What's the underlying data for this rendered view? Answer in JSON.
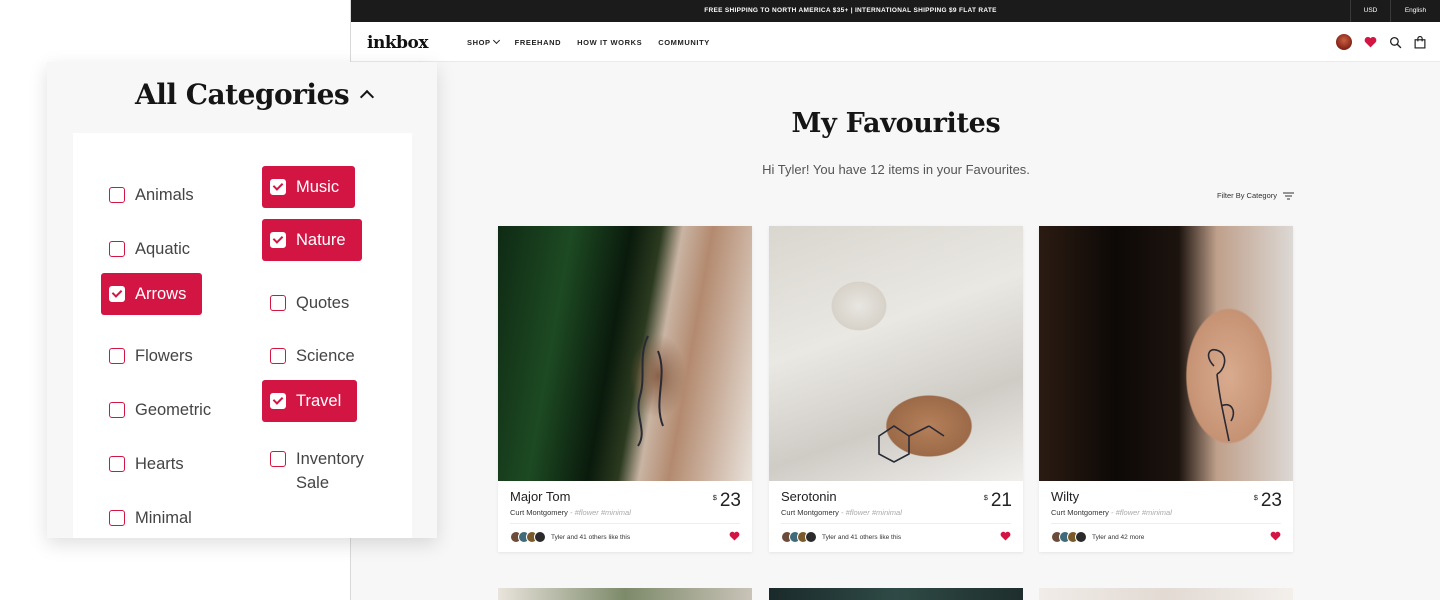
{
  "site": {
    "topbar": {
      "promo": "FREE SHIPPING TO NORTH AMERICA $35+ | INTERNATIONAL SHIPPING $9 FLAT RATE",
      "currency": "USD",
      "language": "English"
    },
    "logo": "inkbox",
    "nav": [
      {
        "label": "SHOP",
        "dropdown": true
      },
      {
        "label": "FREEHAND"
      },
      {
        "label": "HOW IT WORKS"
      },
      {
        "label": "COMMUNITY"
      }
    ],
    "icons": [
      "avatar",
      "heart-icon",
      "search-icon",
      "bag-icon"
    ],
    "accent": "#d31543"
  },
  "favourites": {
    "title": "My Favourites",
    "greeting": "Hi Tyler! You have 12 items in your Favourites.",
    "filter_label": "Filter By Category",
    "items": [
      {
        "name": "Major Tom",
        "artist": "Curt Montgomery",
        "tags": "- #flower #minimal",
        "currency": "$",
        "price": "23",
        "likes": "Tyler and 41 others like this"
      },
      {
        "name": "Serotonin",
        "artist": "Curt Montgomery",
        "tags": "- #flower #minimal",
        "currency": "$",
        "price": "21",
        "likes": "Tyler and 41 others like this"
      },
      {
        "name": "Wilty",
        "artist": "Curt Montgomery",
        "tags": "- #flower #minimal",
        "currency": "$",
        "price": "23",
        "likes": "Tyler and 42 more"
      }
    ]
  },
  "categories": {
    "title": "All Categories",
    "items": [
      {
        "label": "Animals",
        "checked": false
      },
      {
        "label": "Aquatic",
        "checked": false
      },
      {
        "label": "Arrows",
        "checked": true
      },
      {
        "label": "Flowers",
        "checked": false
      },
      {
        "label": "Geometric",
        "checked": false
      },
      {
        "label": "Hearts",
        "checked": false
      },
      {
        "label": "Minimal",
        "checked": false
      },
      {
        "label": "Music",
        "checked": true
      },
      {
        "label": "Nature",
        "checked": true
      },
      {
        "label": "Quotes",
        "checked": false
      },
      {
        "label": "Science",
        "checked": false
      },
      {
        "label": "Travel",
        "checked": true
      },
      {
        "label": "Inventory Sale",
        "checked": false
      }
    ]
  }
}
